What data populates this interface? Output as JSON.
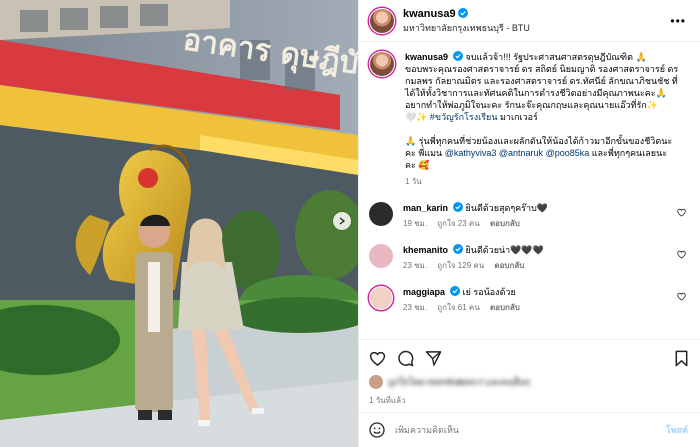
{
  "photo": {
    "alt": "two people posing in front of a building",
    "sign_text": "อาคาร ดุษฎีบัณฑิต"
  },
  "header": {
    "username": "kwanusa9",
    "location": "มหาวิทยาลัยกรุงเทพธนบุรี - BTU",
    "more_icon": "more-horizontal-icon",
    "verified_icon": "verified-badge-icon"
  },
  "caption": {
    "username": "kwanusa9",
    "lines": [
      "จบแล้วจ้า!!! รัฐประศาสนศาสตรดุษฎีบัณฑิต 🙏",
      "ขอบพระคุณรองศาสตราจารย์ ดร สถิตย์ นิยมญาติ รองศาสตราจารย์ ดร",
      "กมลพร กัลยาณมิตร และรองศาสตราจารย์ ดร.ทัศนีย์ ลักขณาภิชนชัช ที่",
      "ได้ให้ทั้งวิชาการและทัศนคติในการดำรงชีวิตอย่างมีคุณภาพนะคะ🙏",
      "อยากทำให้พ่อภูมิใจนะคะ รักนะจ๊ะคุณกฤษและคุณนายแอ๊วที่รัก✨"
    ],
    "hashtag_line_prefix": "🤍✨ ",
    "hashtag": "#ขวัญรักโรงเรียน",
    "hashtag_line_suffix": " มาเกเวอร์",
    "thanks_lines": [
      "🙏 รุ่นพี่ทุกคนที่ช่วยน้องและผลักดันให้น้องได้ก้าวมาอีกขั้นของชีวิตนะ",
      "คะ พี่แมน "
    ],
    "mentions": [
      "@kathyviva3",
      "@antnaruk",
      "@poo85ka"
    ],
    "thanks_tail": " และพี่ทุกๆคนเลยนะ",
    "thanks_last": "คะ 🥰",
    "time": "1 วัน"
  },
  "comments": [
    {
      "username": "man_karin",
      "text": "ยินดีด้วยสุดๆคร๊าบ🖤",
      "time": "19 ชม.",
      "likes": "ถูกใจ 23 คน",
      "reply": "ตอบกลับ",
      "avatar_color": "#2b2b2b"
    },
    {
      "username": "khemanito",
      "text": "ยินดีด้วยน่า🖤🖤🖤",
      "time": "23 ชม.",
      "likes": "ถูกใจ 129 คน",
      "reply": "ตอบกลับ",
      "avatar_color": "#e8b7c0"
    },
    {
      "username": "maggiapa",
      "text": "เย่ รอน้องด้วย",
      "time": "23 ชม.",
      "likes": "ถูกใจ 61 คน",
      "reply": "ตอบกลับ",
      "avatar_color": "#f0d2c4"
    }
  ],
  "actions": {
    "like_icon": "heart-icon",
    "comment_icon": "comment-icon",
    "share_icon": "send-icon",
    "save_icon": "bookmark-icon",
    "likes_text": "ถูกใจโดย mornthakorn.f และคนอื่นๆ",
    "post_time": "1 วันที่แล้ว"
  },
  "add_comment": {
    "emoji_icon": "emoji-smile-icon",
    "placeholder": "เพิ่มความคิดเห็น",
    "post_label": "โพสต์"
  },
  "colors": {
    "link": "#00376b",
    "muted": "#737373",
    "verified": "#0095f6",
    "post_disabled": "#a3d5fc"
  }
}
